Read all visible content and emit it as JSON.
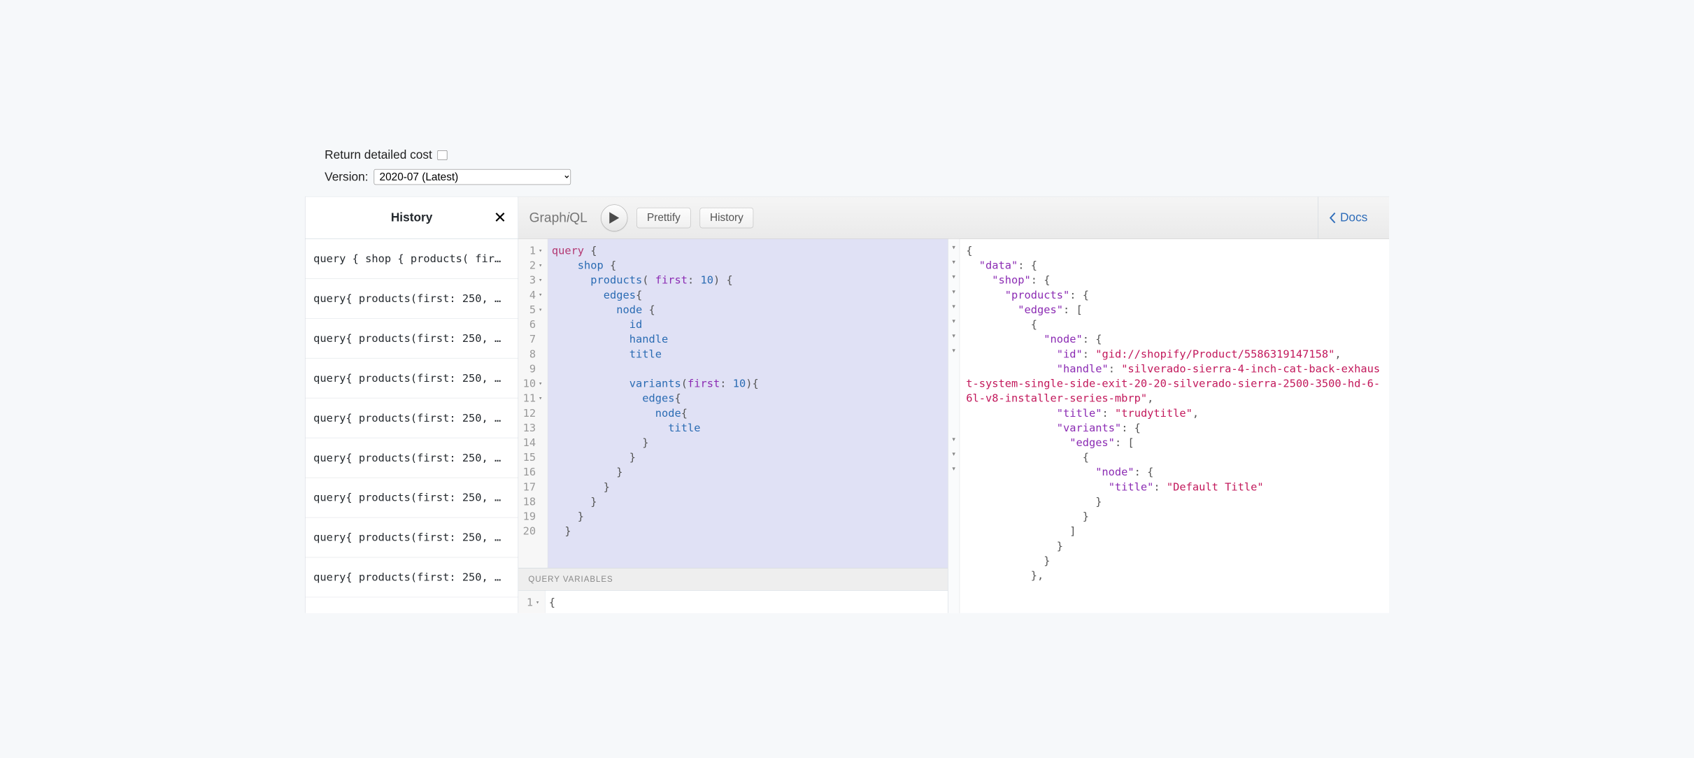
{
  "topControls": {
    "detailedCostLabel": "Return detailed cost",
    "detailedCostChecked": false,
    "versionLabel": "Version:",
    "versionSelected": "2020-07 (Latest)"
  },
  "historyPanel": {
    "title": "History",
    "items": [
      "query { shop { products( fir…",
      "query{ products(first: 250, …",
      "query{ products(first: 250, …",
      "query{ products(first: 250, …",
      "query{ products(first: 250, …",
      "query{ products(first: 250, …",
      "query{ products(first: 250, …",
      "query{ products(first: 250, …",
      "query{ products(first: 250, …"
    ]
  },
  "toolbar": {
    "logo": "GraphiQL",
    "prettify": "Prettify",
    "history": "History",
    "docs": "Docs"
  },
  "queryEditor": {
    "lines": [
      {
        "n": 1,
        "fold": true,
        "tokens": [
          [
            "kw",
            "query"
          ],
          [
            "punc",
            " {"
          ]
        ]
      },
      {
        "n": 2,
        "fold": true,
        "tokens": [
          [
            "pad",
            "    "
          ],
          [
            "field",
            "shop"
          ],
          [
            "punc",
            " {"
          ]
        ]
      },
      {
        "n": 3,
        "fold": true,
        "tokens": [
          [
            "pad",
            "      "
          ],
          [
            "field",
            "products"
          ],
          [
            "punc",
            "( "
          ],
          [
            "arg",
            "first"
          ],
          [
            "punc",
            ": "
          ],
          [
            "num",
            "10"
          ],
          [
            "punc",
            ") {"
          ]
        ]
      },
      {
        "n": 4,
        "fold": true,
        "tokens": [
          [
            "pad",
            "        "
          ],
          [
            "field",
            "edges"
          ],
          [
            "punc",
            "{"
          ]
        ]
      },
      {
        "n": 5,
        "fold": true,
        "tokens": [
          [
            "pad",
            "          "
          ],
          [
            "field",
            "node"
          ],
          [
            "punc",
            " {"
          ]
        ]
      },
      {
        "n": 6,
        "fold": false,
        "tokens": [
          [
            "pad",
            "            "
          ],
          [
            "field",
            "id"
          ]
        ]
      },
      {
        "n": 7,
        "fold": false,
        "tokens": [
          [
            "pad",
            "            "
          ],
          [
            "field",
            "handle"
          ]
        ]
      },
      {
        "n": 8,
        "fold": false,
        "tokens": [
          [
            "pad",
            "            "
          ],
          [
            "field",
            "title"
          ]
        ]
      },
      {
        "n": 9,
        "fold": false,
        "tokens": [
          [
            "pad",
            ""
          ]
        ]
      },
      {
        "n": 10,
        "fold": true,
        "tokens": [
          [
            "pad",
            "            "
          ],
          [
            "field",
            "variants"
          ],
          [
            "punc",
            "("
          ],
          [
            "arg",
            "first"
          ],
          [
            "punc",
            ": "
          ],
          [
            "num",
            "10"
          ],
          [
            "punc",
            "){"
          ]
        ]
      },
      {
        "n": 11,
        "fold": true,
        "tokens": [
          [
            "pad",
            "              "
          ],
          [
            "field",
            "edges"
          ],
          [
            "punc",
            "{"
          ]
        ]
      },
      {
        "n": 12,
        "fold": false,
        "tokens": [
          [
            "pad",
            "                "
          ],
          [
            "field",
            "node"
          ],
          [
            "punc",
            "{"
          ]
        ]
      },
      {
        "n": 13,
        "fold": false,
        "tokens": [
          [
            "pad",
            "                  "
          ],
          [
            "field",
            "title"
          ]
        ]
      },
      {
        "n": 14,
        "fold": false,
        "tokens": [
          [
            "pad",
            "              "
          ],
          [
            "punc",
            "}"
          ]
        ]
      },
      {
        "n": 15,
        "fold": false,
        "tokens": [
          [
            "pad",
            "            "
          ],
          [
            "punc",
            "}"
          ]
        ]
      },
      {
        "n": 16,
        "fold": false,
        "tokens": [
          [
            "pad",
            "          "
          ],
          [
            "punc",
            "}"
          ]
        ]
      },
      {
        "n": 17,
        "fold": false,
        "tokens": [
          [
            "pad",
            "        "
          ],
          [
            "punc",
            "}"
          ]
        ]
      },
      {
        "n": 18,
        "fold": false,
        "tokens": [
          [
            "pad",
            "      "
          ],
          [
            "punc",
            "}"
          ]
        ]
      },
      {
        "n": 19,
        "fold": false,
        "tokens": [
          [
            "pad",
            "    "
          ],
          [
            "punc",
            "}"
          ]
        ]
      },
      {
        "n": 20,
        "fold": false,
        "tokens": [
          [
            "pad",
            "  "
          ],
          [
            "punc",
            "}"
          ]
        ]
      }
    ]
  },
  "variablesSection": {
    "header": "Query Variables",
    "lines": [
      {
        "n": 1,
        "fold": true,
        "text": "{"
      }
    ]
  },
  "results": {
    "foldRows": [
      true,
      true,
      true,
      true,
      true,
      true,
      true,
      true,
      false,
      false,
      false,
      false,
      false,
      true,
      true,
      true,
      false,
      false
    ],
    "lines": [
      [
        [
          "jp",
          "{"
        ]
      ],
      [
        [
          "jp",
          "  "
        ],
        [
          "jk",
          "\"data\""
        ],
        [
          "jp",
          ": {"
        ]
      ],
      [
        [
          "jp",
          "    "
        ],
        [
          "jk",
          "\"shop\""
        ],
        [
          "jp",
          ": {"
        ]
      ],
      [
        [
          "jp",
          "      "
        ],
        [
          "jk",
          "\"products\""
        ],
        [
          "jp",
          ": {"
        ]
      ],
      [
        [
          "jp",
          "        "
        ],
        [
          "jk",
          "\"edges\""
        ],
        [
          "jp",
          ": ["
        ]
      ],
      [
        [
          "jp",
          "          {"
        ]
      ],
      [
        [
          "jp",
          "            "
        ],
        [
          "jk",
          "\"node\""
        ],
        [
          "jp",
          ": {"
        ]
      ],
      [
        [
          "jp",
          "              "
        ],
        [
          "jk",
          "\"id\""
        ],
        [
          "jp",
          ": "
        ],
        [
          "js",
          "\"gid://shopify/Product/5586319147158\""
        ],
        [
          "jp",
          ","
        ]
      ],
      [
        [
          "jp",
          "              "
        ],
        [
          "jk",
          "\"handle\""
        ],
        [
          "jp",
          ": "
        ],
        [
          "js",
          "\"silverado-sierra-4-inch-cat-back-exhaust-system-single-side-exit-20-20-silverado-sierra-2500-3500-hd-6-6l-v8-installer-series-mbrp\""
        ],
        [
          "jp",
          ","
        ]
      ],
      [
        [
          "jp",
          "              "
        ],
        [
          "jk",
          "\"title\""
        ],
        [
          "jp",
          ": "
        ],
        [
          "js",
          "\"trudytitle\""
        ],
        [
          "jp",
          ","
        ]
      ],
      [
        [
          "jp",
          "              "
        ],
        [
          "jk",
          "\"variants\""
        ],
        [
          "jp",
          ": {"
        ]
      ],
      [
        [
          "jp",
          "                "
        ],
        [
          "jk",
          "\"edges\""
        ],
        [
          "jp",
          ": ["
        ]
      ],
      [
        [
          "jp",
          "                  {"
        ]
      ],
      [
        [
          "jp",
          "                    "
        ],
        [
          "jk",
          "\"node\""
        ],
        [
          "jp",
          ": {"
        ]
      ],
      [
        [
          "jp",
          "                      "
        ],
        [
          "jk",
          "\"title\""
        ],
        [
          "jp",
          ": "
        ],
        [
          "js",
          "\"Default Title\""
        ]
      ],
      [
        [
          "jp",
          "                    }"
        ]
      ],
      [
        [
          "jp",
          "                  }"
        ]
      ],
      [
        [
          "jp",
          "                ]"
        ]
      ],
      [
        [
          "jp",
          "              }"
        ]
      ],
      [
        [
          "jp",
          "            }"
        ]
      ],
      [
        [
          "jp",
          "          },"
        ]
      ]
    ]
  }
}
